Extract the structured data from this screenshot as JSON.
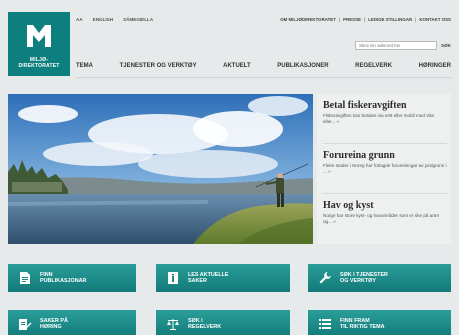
{
  "logo": {
    "line1": "MILJØ-",
    "line2": "DIREKTORATET"
  },
  "lang": [
    "AA",
    "ENGLISH",
    "SÁMEGIELLA"
  ],
  "toplinks": [
    "OM MILJØDIREKTORATET",
    "PRESSE",
    "LEDIGE STILLINGAR",
    "KONTAKT OSS"
  ],
  "search": {
    "placeholder": "Skriv inn søkeord her",
    "button": "SØK"
  },
  "nav": [
    "TEMA",
    "TJENESTER OG VERKTØY",
    "AKTUELT",
    "PUBLIKASJONER",
    "REGELVERK",
    "HØRINGER"
  ],
  "news": [
    {
      "title": "Betal fiskeravgiften",
      "desc": "Fiskeravgiften kan betales via nett eller mobil med Vita eller... »"
    },
    {
      "title": "Forureina grunn",
      "desc": "Fleire stader i Noreg har forlagde forureiningar av jordgrunn i ... »"
    },
    {
      "title": "Hav og kyst",
      "desc": "Norge har store kyst- og havområder som er rike på arter og... »"
    }
  ],
  "tiles": [
    {
      "line1": "FINN",
      "line2": "PUBLIKASJONAR",
      "icon": "document-icon"
    },
    {
      "line1": "LES AKTUELLE",
      "line2": "SAKER",
      "icon": "article-icon"
    },
    {
      "line1": "SØK I TJENESTER",
      "line2": "OG VERKTØY",
      "icon": "wrench-icon"
    },
    {
      "line1": "SAKER PÅ",
      "line2": "HØRING",
      "icon": "edit-document-icon"
    },
    {
      "line1": "SØK I",
      "line2": "REGELVERK",
      "icon": "scales-icon"
    },
    {
      "line1": "FINN FRAM",
      "line2": "TIL RIKTIG TEMA",
      "icon": "list-icon"
    }
  ],
  "colors": {
    "brand": "#0e7f7f",
    "tile": "#1a8986",
    "background": "#e7eaea"
  }
}
